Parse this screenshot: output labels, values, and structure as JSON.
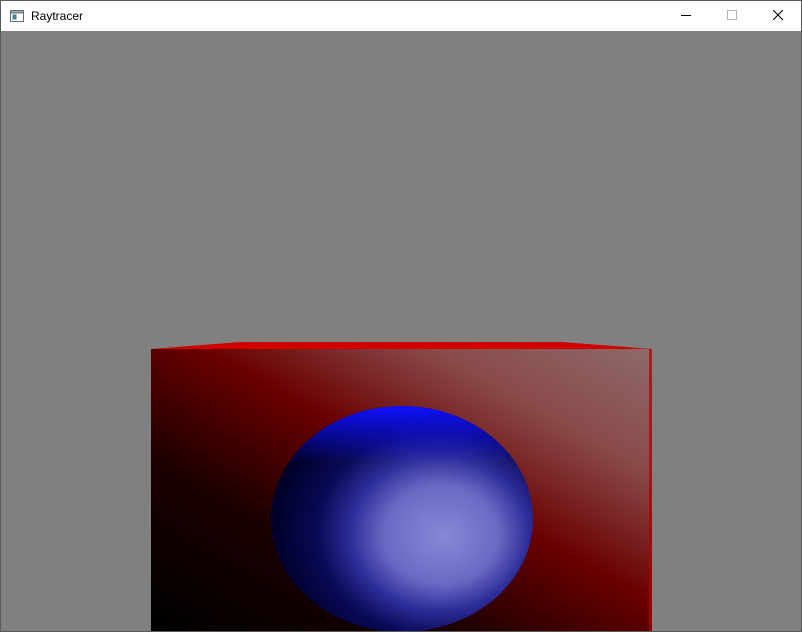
{
  "window": {
    "title": "Raytracer",
    "controls": {
      "minimize": "minimize-icon",
      "maximize": "maximize-icon",
      "close": "close-icon"
    }
  },
  "scene": {
    "background_color": "#808080",
    "box_color": "#cc0000",
    "sphere_color": "#0000ff"
  }
}
